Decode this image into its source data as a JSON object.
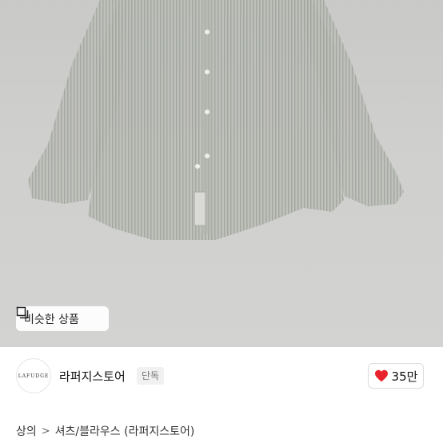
{
  "product": {
    "image_alt": "striped shirt product photo",
    "similar_button_label": "비슷한 상품"
  },
  "store": {
    "logo_text": "LAFUDGE",
    "name": "라퍼지스토어",
    "badge": "단독",
    "likes": "35만",
    "heart_color": "#e8232b"
  },
  "breadcrumb": {
    "items": [
      "상의",
      "셔츠/블라우스 (라퍼지스토어)"
    ],
    "separator": ">"
  }
}
